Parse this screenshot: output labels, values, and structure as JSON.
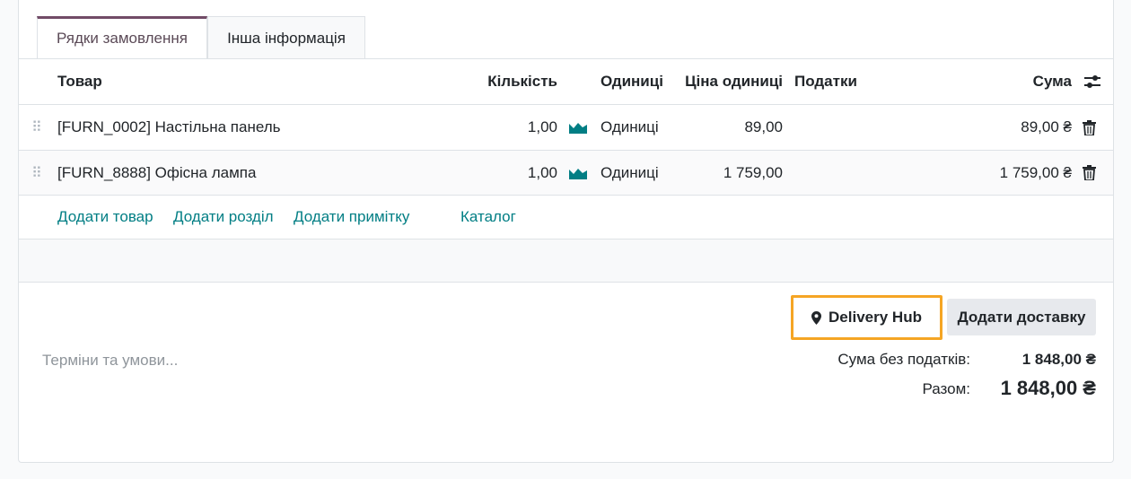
{
  "tabs": [
    {
      "label": "Рядки замовлення",
      "active": true
    },
    {
      "label": "Інша інформація",
      "active": false
    }
  ],
  "table": {
    "columns": {
      "product": "Товар",
      "quantity": "Кількість",
      "units": "Одиниці",
      "unit_price": "Ціна одиниці",
      "taxes": "Податки",
      "subtotal": "Сума"
    },
    "rows": [
      {
        "product": "[FURN_0002] Настільна панель",
        "quantity": "1,00",
        "units": "Одиниці",
        "unit_price": "89,00",
        "taxes": "",
        "subtotal": "89,00 ₴"
      },
      {
        "product": "[FURN_8888] Офісна лампа",
        "quantity": "1,00",
        "units": "Одиниці",
        "unit_price": "1 759,00",
        "taxes": "",
        "subtotal": "1 759,00 ₴"
      }
    ],
    "add_links": {
      "add_product": "Додати товар",
      "add_section": "Додати розділ",
      "add_note": "Додати примітку",
      "catalog": "Каталог"
    }
  },
  "footer": {
    "delivery_hub": "Delivery Hub",
    "add_delivery": "Додати доставку",
    "terms_placeholder": "Терміни та умови...",
    "untaxed_label": "Сума без податків:",
    "untaxed_value": "1 848,00 ₴",
    "total_label": "Разом:",
    "total_value": "1 848,00 ₴"
  },
  "colors": {
    "accent_teal": "#017e84",
    "tab_active_border": "#714b67",
    "highlight_orange": "#f5a524"
  }
}
